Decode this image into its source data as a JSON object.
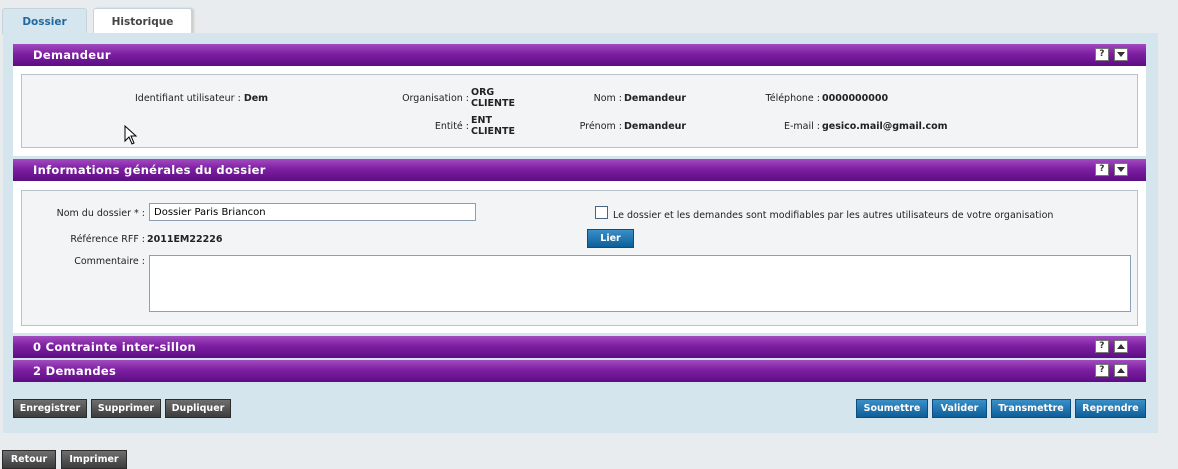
{
  "tabs": [
    {
      "label": "Dossier"
    },
    {
      "label": "Historique"
    }
  ],
  "demandeur": {
    "title": "Demandeur",
    "help": "?",
    "fields": {
      "identifiant_label": "Identifiant utilisateur :",
      "identifiant_value": "Dem",
      "organisation_label": "Organisation :",
      "organisation_value_1": "ORG",
      "organisation_value_2": "CLIENTE",
      "entite_label": "Entité :",
      "entite_value_1": "ENT",
      "entite_value_2": "CLIENTE",
      "nom_label": "Nom :",
      "nom_value": "Demandeur",
      "prenom_label": "Prénom :",
      "prenom_value": "Demandeur",
      "telephone_label": "Téléphone :",
      "telephone_value": "0000000000",
      "email_label": "E-mail :",
      "email_value": "gesico.mail@gmail.com"
    }
  },
  "infos": {
    "title": "Informations générales du dossier",
    "help": "?",
    "nom_label": "Nom du dossier * :",
    "nom_value": "Dossier Paris Briancon",
    "ref_label": "Référence RFF :",
    "ref_value": "2011EM22226",
    "commentaire_label": "Commentaire :",
    "commentaire_value": "",
    "checkbox_label": "Le dossier et les demandes sont modifiables par les autres utilisateurs de votre organisation",
    "checkbox_checked": false,
    "lier_label": "Lier"
  },
  "contraintes": {
    "title": "0 Contrainte inter-sillon",
    "help": "?"
  },
  "demandes": {
    "title": "2 Demandes",
    "help": "?"
  },
  "actions_left": [
    "Enregistrer",
    "Supprimer",
    "Dupliquer"
  ],
  "actions_right": [
    "Soumettre",
    "Valider",
    "Transmettre",
    "Reprendre"
  ],
  "footer_actions": [
    "Retour",
    "Imprimer"
  ],
  "colors": {
    "section_bar": "#7d1fa1",
    "panel_bg": "#d5e5ee",
    "primary_button": "#0d5e99",
    "secondary_button": "#3c3c3c",
    "active_tab_text": "#2268a0"
  }
}
